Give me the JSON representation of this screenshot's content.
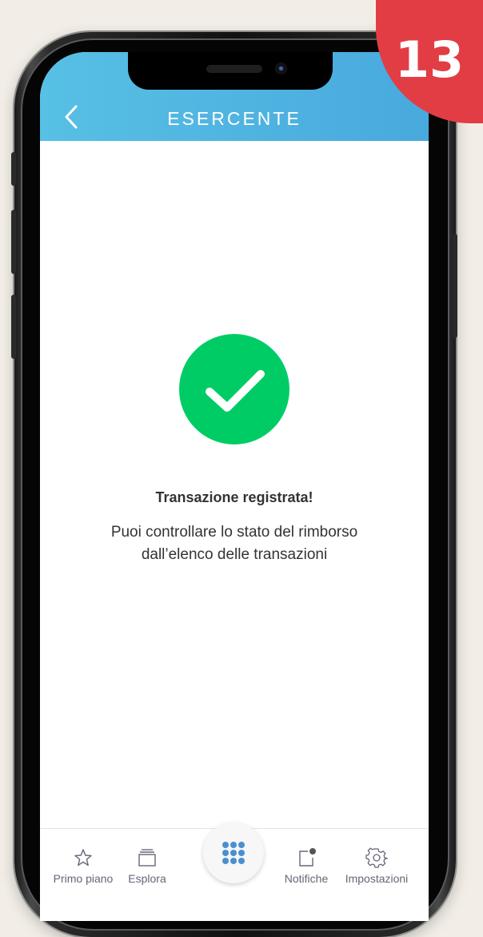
{
  "header": {
    "title": "ESERCENTE"
  },
  "status": {
    "title": "Transazione registrata!",
    "message_line1": "Puoi controllare lo stato del rimborso",
    "message_line2": "dall’elenco delle transazioni"
  },
  "tabbar": {
    "items": [
      {
        "label": "Primo piano",
        "icon": "star-icon"
      },
      {
        "label": "Esplora",
        "icon": "stack-icon"
      },
      {
        "label": "",
        "icon": "grid-icon"
      },
      {
        "label": "Notifiche",
        "icon": "notification-icon"
      },
      {
        "label": "Impostazioni",
        "icon": "gear-icon"
      }
    ]
  },
  "step_badge": {
    "number": "13"
  },
  "colors": {
    "header_gradient_start": "#57c0e4",
    "header_gradient_end": "#49a9de",
    "success_green": "#00cc66",
    "badge_red": "#e23d44",
    "grid_blue": "#4a8fd0"
  }
}
